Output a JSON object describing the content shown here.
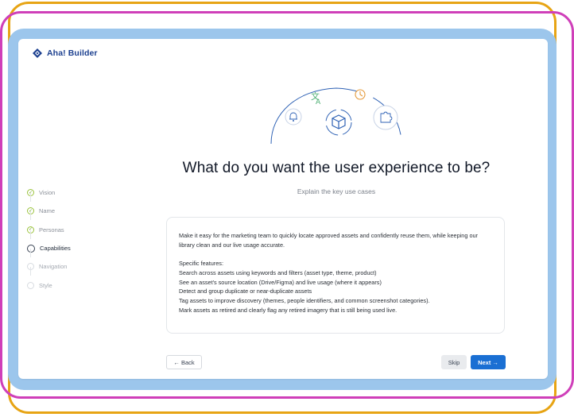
{
  "app": {
    "name": "Aha! Builder",
    "brand_color": "#1b3f8f",
    "accent_color": "#1a6fd3"
  },
  "steps": [
    {
      "label": "Vision",
      "status": "done"
    },
    {
      "label": "Name",
      "status": "done"
    },
    {
      "label": "Personas",
      "status": "done"
    },
    {
      "label": "Capabilities",
      "status": "active"
    },
    {
      "label": "Navigation",
      "status": "upcoming"
    },
    {
      "label": "Style",
      "status": "upcoming"
    }
  ],
  "main": {
    "title": "What do you want the user experience to be?",
    "subtitle": "Explain the key use cases",
    "textbox": {
      "intro": "Make it easy for the marketing team to quickly locate approved assets and confidently reuse them, while keeping our library clean and our live usage accurate.",
      "features_heading": "Specific features:",
      "features": [
        "Search across assets using keywords and filters (asset type, theme, product)",
        "See an asset's source location (Drive/Figma) and live usage (where it appears)",
        "Detect and group duplicate or near-duplicate assets",
        "Tag assets to improve discovery (themes, people identifiers, and common screenshot categories).",
        "Mark assets as retired and clearly flag any retired imagery that is still being used live."
      ]
    }
  },
  "buttons": {
    "back": "← Back",
    "skip": "Skip",
    "next": "Next →"
  },
  "illustration_icons": [
    "bell-icon",
    "translate-icon",
    "clock-icon",
    "cube-icon",
    "puzzle-icon"
  ]
}
